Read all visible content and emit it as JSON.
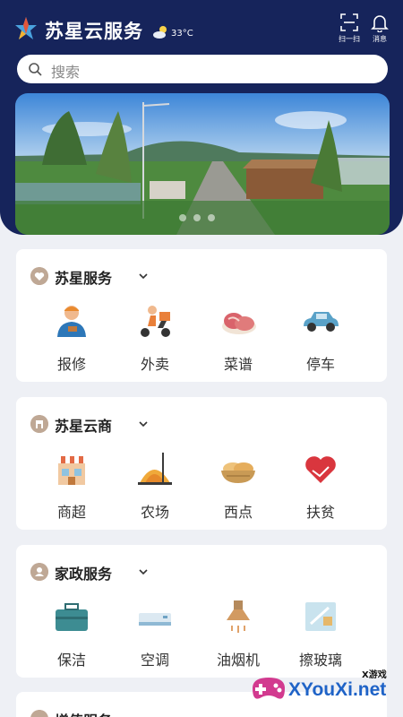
{
  "header": {
    "title": "苏星云服务",
    "logo_icon": "star-logo-icon",
    "weather_icon": "cloudy-sun-icon",
    "temperature": "33°C",
    "actions": [
      {
        "label": "扫一扫",
        "icon": "scan-icon"
      },
      {
        "label": "消息",
        "icon": "bell-icon"
      }
    ],
    "bg_color": "#16245b"
  },
  "search": {
    "placeholder": "搜索",
    "icon": "search-icon"
  },
  "banner": {
    "icon": "countryside-road-photo",
    "dots": 3
  },
  "sections": [
    {
      "title": "苏星服务",
      "icon": "heart-badge-icon",
      "items": [
        {
          "label": "报修",
          "icon": "repair-worker-icon"
        },
        {
          "label": "外卖",
          "icon": "delivery-scooter-icon"
        },
        {
          "label": "菜谱",
          "icon": "meat-dish-icon"
        },
        {
          "label": "停车",
          "icon": "car-icon"
        }
      ]
    },
    {
      "title": "苏星云商",
      "icon": "shop-badge-icon",
      "items": [
        {
          "label": "商超",
          "icon": "supermarket-icon"
        },
        {
          "label": "农场",
          "icon": "farm-icon"
        },
        {
          "label": "西点",
          "icon": "bread-basket-icon"
        },
        {
          "label": "扶贫",
          "icon": "heart-hands-icon"
        }
      ]
    },
    {
      "title": "家政服务",
      "icon": "person-badge-icon",
      "items": [
        {
          "label": "保洁",
          "icon": "toolbox-icon"
        },
        {
          "label": "空调",
          "icon": "air-conditioner-icon"
        },
        {
          "label": "油烟机",
          "icon": "range-hood-icon"
        },
        {
          "label": "擦玻璃",
          "icon": "window-cleaning-icon"
        }
      ]
    },
    {
      "title": "增值服务",
      "icon": "badge-icon"
    }
  ],
  "watermark": {
    "text": "XYouXi.net",
    "small": "X游戏"
  }
}
